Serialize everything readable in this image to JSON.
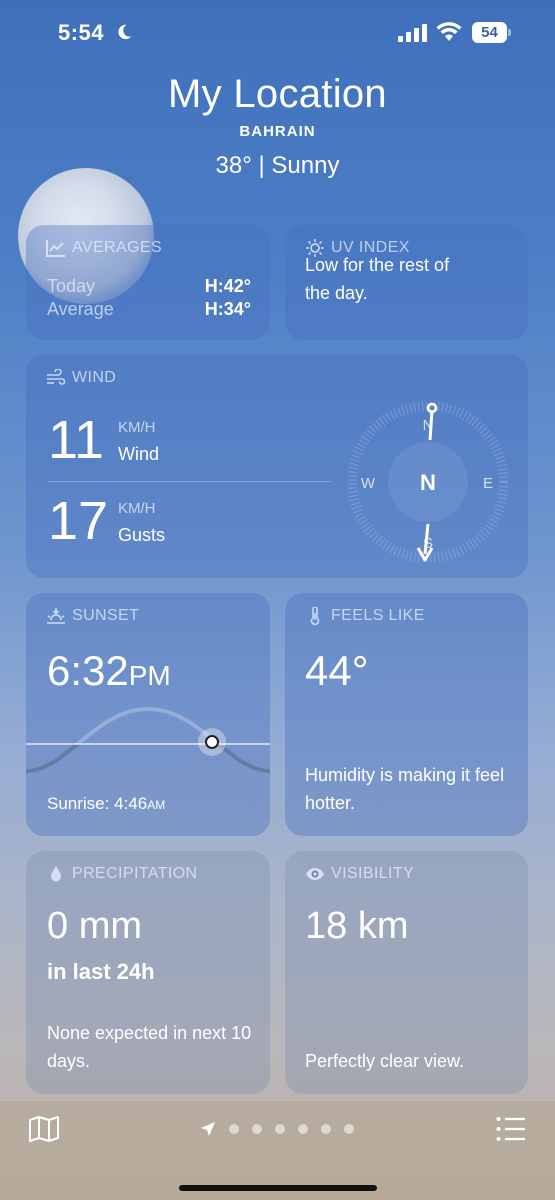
{
  "status": {
    "time": "5:54",
    "battery": "54"
  },
  "header": {
    "title": "My Location",
    "subtitle": "BAHRAIN",
    "conditions": "38°  |  Sunny"
  },
  "averages": {
    "title": "AVERAGES",
    "rows": [
      {
        "label": "Today",
        "value": "H:42°"
      },
      {
        "label": "Average",
        "value": "H:34°"
      }
    ]
  },
  "uv": {
    "title": "UV INDEX",
    "text_cut": "Low for the rest of",
    "text": "the day."
  },
  "wind": {
    "title": "WIND",
    "wind_value": "11",
    "wind_unit": "KM/H",
    "wind_label": "Wind",
    "gust_value": "17",
    "gust_unit": "KM/H",
    "gust_label": "Gusts",
    "compass": {
      "north": "N",
      "west": "W",
      "east": "E",
      "south": "S",
      "center": "N"
    }
  },
  "sunset": {
    "title": "SUNSET",
    "time": "6:32",
    "ampm": "PM",
    "sunrise_label": "Sunrise: 4:46",
    "sunrise_ampm": "AM"
  },
  "feels_like": {
    "title": "FEELS LIKE",
    "value": "44°",
    "note": "Humidity is making it feel hotter."
  },
  "precipitation": {
    "title": "PRECIPITATION",
    "value": "0 mm",
    "sub": "in last 24h",
    "note": "None expected in next 10 days."
  },
  "visibility": {
    "title": "VISIBILITY",
    "value": "18 km",
    "note": "Perfectly clear view."
  },
  "icons": [
    "moon-icon",
    "cellular-signal-icon",
    "wifi-icon",
    "battery-icon",
    "chart-icon",
    "sun-icon",
    "wind-icon",
    "sunset-icon",
    "thermometer-icon",
    "drop-icon",
    "eye-icon",
    "map-icon",
    "location-arrow-icon",
    "list-icon"
  ]
}
